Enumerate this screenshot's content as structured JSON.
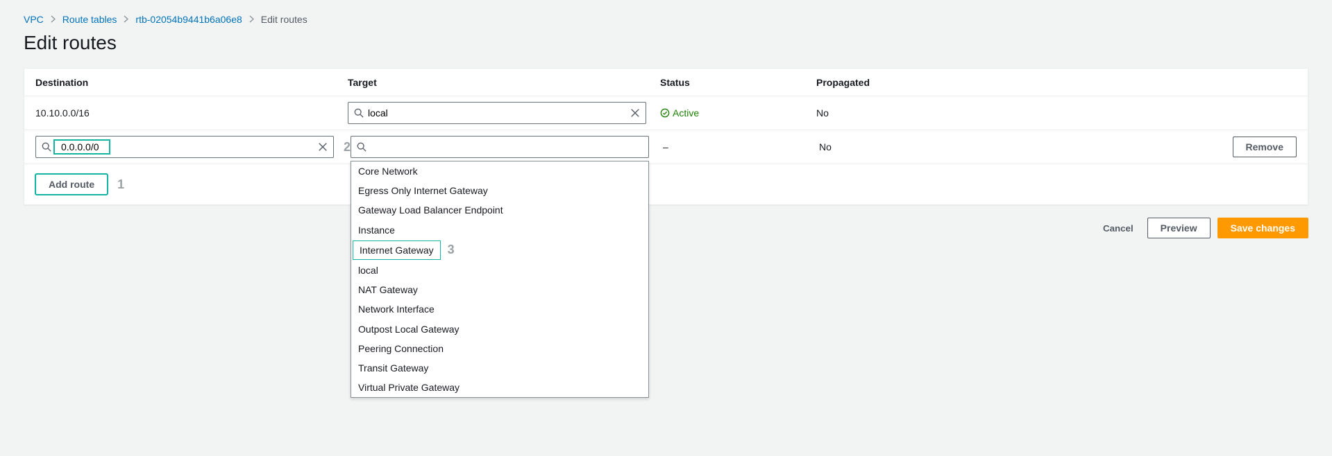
{
  "breadcrumbs": {
    "items": [
      "VPC",
      "Route tables",
      "rtb-02054b9441b6a06e8"
    ],
    "current": "Edit routes"
  },
  "page_title": "Edit routes",
  "table": {
    "headers": {
      "destination": "Destination",
      "target": "Target",
      "status": "Status",
      "propagated": "Propagated"
    },
    "rows": [
      {
        "destination": "10.10.0.0/16",
        "target": "local",
        "status": "Active",
        "propagated": "No"
      },
      {
        "destination_value": "0.0.0.0/0",
        "target_value": "",
        "status": "–",
        "propagated": "No",
        "remove_label": "Remove"
      }
    ],
    "add_route_label": "Add route"
  },
  "dropdown_options": [
    "Core Network",
    "Egress Only Internet Gateway",
    "Gateway Load Balancer Endpoint",
    "Instance",
    "Internet Gateway",
    "local",
    "NAT Gateway",
    "Network Interface",
    "Outpost Local Gateway",
    "Peering Connection",
    "Transit Gateway",
    "Virtual Private Gateway"
  ],
  "annotations": {
    "one": "1",
    "two": "2",
    "three": "3"
  },
  "actions": {
    "cancel": "Cancel",
    "preview": "Preview",
    "save": "Save changes"
  }
}
